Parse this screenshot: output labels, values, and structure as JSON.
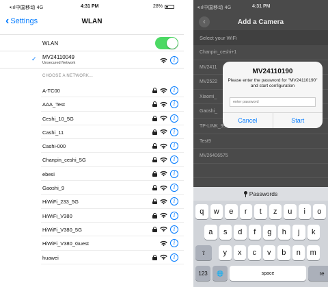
{
  "left": {
    "status": {
      "carrier": "•ııl中国移动 4G",
      "time": "4:31 PM",
      "battery": "28%"
    },
    "nav": {
      "back_label": "Settings",
      "title": "WLAN"
    },
    "wlan": {
      "label": "WLAN",
      "enabled": true
    },
    "current": {
      "name": "MV24110049",
      "subtitle": "Unsecured Network"
    },
    "section_header": "CHOOSE A NETWORK...",
    "networks": [
      {
        "name": "A-TC00",
        "locked": true
      },
      {
        "name": "AAA_Test",
        "locked": true
      },
      {
        "name": "Ceshi_10_5G",
        "locked": true
      },
      {
        "name": "Cashi_11",
        "locked": true
      },
      {
        "name": "Cashi-000",
        "locked": true
      },
      {
        "name": "Chanpin_ceshi_5G",
        "locked": true
      },
      {
        "name": "ebesi",
        "locked": true
      },
      {
        "name": "Gaoshi_9",
        "locked": true
      },
      {
        "name": "HiWiFi_233_5G",
        "locked": true
      },
      {
        "name": "HiWiFi_V380",
        "locked": true
      },
      {
        "name": "HiWiFi_V380_5G",
        "locked": true
      },
      {
        "name": "HiWiFi_V380_Guest",
        "locked": false
      },
      {
        "name": "huawei",
        "locked": true
      }
    ]
  },
  "right": {
    "status": {
      "carrier": "•ııl中国移动 4G",
      "time": "4:31 PM"
    },
    "nav": {
      "back": "‹",
      "title": "Add a Camera"
    },
    "subheader": "Select your WiFi",
    "wifi_list": [
      "Chanpin_ceshi+1",
      "MV2411",
      "MV2522",
      "Xiaomi_",
      "Gaoshi_",
      "TP-LINK_9939",
      "Test9",
      "MV26406575",
      ""
    ],
    "dialog": {
      "title": "MV24110190",
      "message": "Please enter the password for \"MV24110190\" and start configuration",
      "placeholder": "enter password",
      "cancel": "Cancel",
      "start": "Start"
    },
    "keyboard": {
      "bar_label": "Passwords",
      "row1": [
        "q",
        "w",
        "e",
        "r",
        "t",
        "z",
        "u",
        "i",
        "o"
      ],
      "row2": [
        "a",
        "s",
        "d",
        "f",
        "g",
        "h",
        "j",
        "k"
      ],
      "row3": [
        "y",
        "x",
        "c",
        "v",
        "b",
        "n",
        "m"
      ],
      "shift": "⇧",
      "numbers": "123",
      "globe": "🌐",
      "space": "space",
      "return": "re"
    }
  },
  "colors": {
    "accent": "#007aff",
    "toggle_on": "#4cd964",
    "overlay": "#4a4a4a"
  }
}
